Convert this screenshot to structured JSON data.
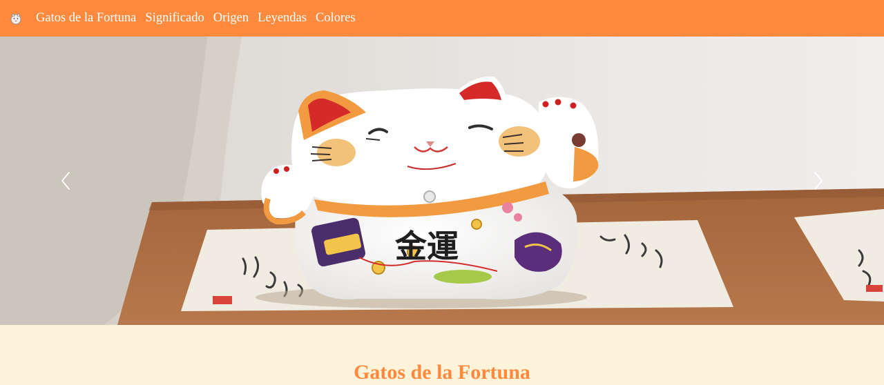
{
  "navbar": {
    "logo_icon": "maneki-neko-icon",
    "links": [
      {
        "label": "Gatos de la Fortuna"
      },
      {
        "label": "Significado"
      },
      {
        "label": "Origen"
      },
      {
        "label": "Leyendas"
      },
      {
        "label": "Colores"
      }
    ],
    "background": "#ff8a3d"
  },
  "carousel": {
    "image": "maneki-neko-figurine-photo",
    "prev_icon": "chevron-left-icon",
    "next_icon": "chevron-right-icon",
    "image_kanji": "金運"
  },
  "section": {
    "title": "Gatos de la Fortuna",
    "title_color": "#ff8a3d",
    "background": "#fdf3da"
  }
}
